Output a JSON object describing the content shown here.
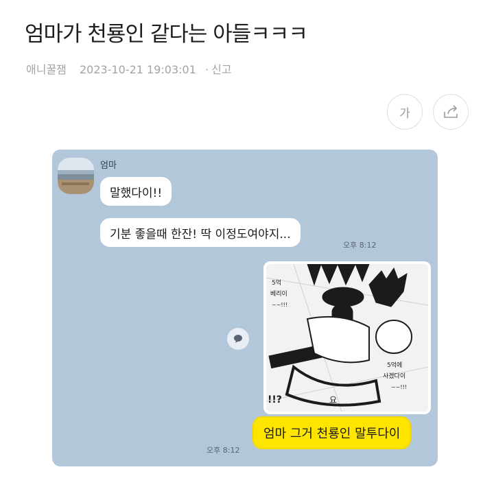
{
  "post": {
    "title": "엄마가 천룡인 같다는 아들ㅋㅋㅋ",
    "author": "애니꿀잼",
    "datetime": "2023-10-21 19:03:01",
    "report_label": "신고"
  },
  "actions": {
    "font_size_label": "가",
    "share_icon": "share-icon"
  },
  "chat": {
    "sender_name": "엄마",
    "messages": [
      {
        "text": "말했다이!!"
      },
      {
        "text": "기분 좋을때 한잔! 딱 이정도여야지..."
      }
    ],
    "time_incoming": "오후 8:12",
    "image_captions": [
      "5억",
      "베리이",
      "~~!!!",
      "5억에",
      "사겠다이",
      "~~!!!",
      "!!?",
      "요"
    ],
    "reply_text": "엄마 그거 천룡인 말투다이",
    "time_outgoing": "오후 8:12"
  },
  "colors": {
    "chat_bg": "#b2c7da",
    "outgoing_bubble": "#fee500",
    "incoming_bubble": "#ffffff"
  }
}
